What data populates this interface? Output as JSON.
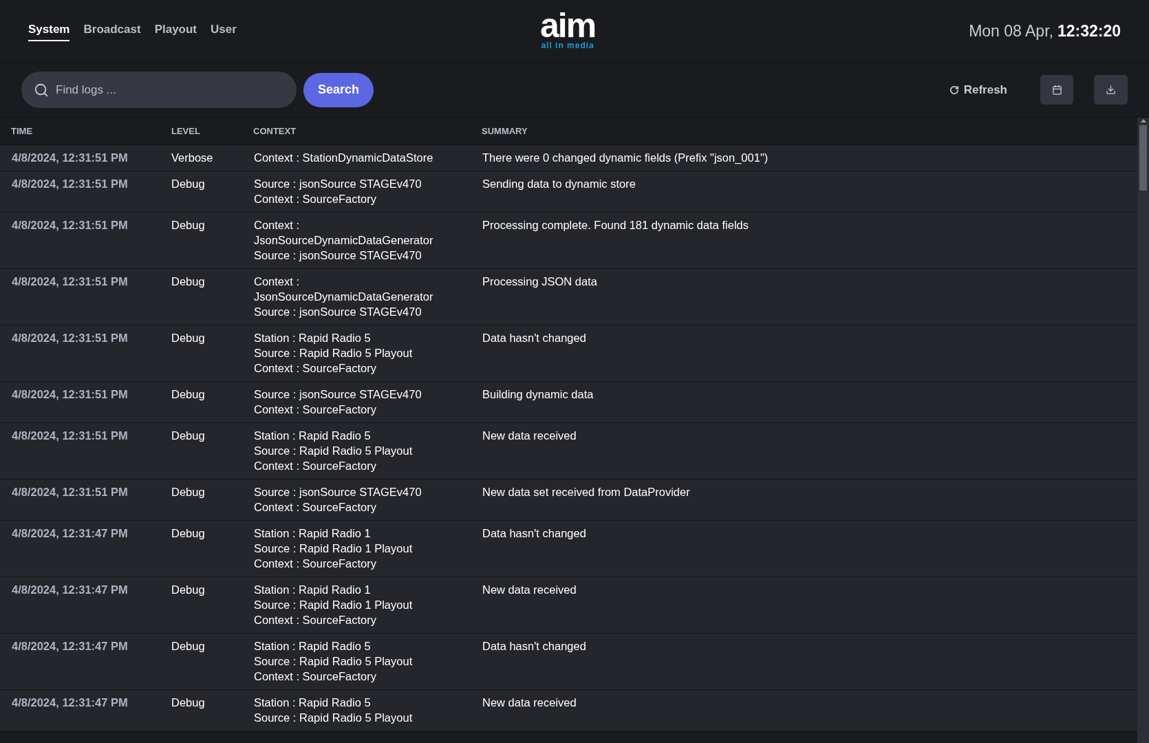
{
  "nav": {
    "tabs": [
      {
        "label": "System",
        "selected": true
      },
      {
        "label": "Broadcast",
        "selected": false
      },
      {
        "label": "Playout",
        "selected": false
      },
      {
        "label": "User",
        "selected": false
      }
    ]
  },
  "logo": {
    "wordmark": "aim",
    "tagline": "all in media"
  },
  "clock": {
    "date": "Mon 08 Apr,",
    "time": "12:32:20"
  },
  "toolbar": {
    "search": {
      "placeholder": "Find logs ..."
    },
    "search_button": "Search",
    "refresh_button": "Refresh"
  },
  "table": {
    "columns": [
      "TIME",
      "LEVEL",
      "CONTEXT",
      "SUMMARY"
    ],
    "rows": [
      {
        "time": "4/8/2024, 12:31:51 PM",
        "level": "Verbose",
        "context": [
          "Context : StationDynamicDataStore"
        ],
        "summary": "There were 0 changed dynamic fields (Prefix \"json_001\")"
      },
      {
        "time": "4/8/2024, 12:31:51 PM",
        "level": "Debug",
        "context": [
          "Source : jsonSource STAGEv470",
          "Context : SourceFactory"
        ],
        "summary": "Sending data to dynamic store"
      },
      {
        "time": "4/8/2024, 12:31:51 PM",
        "level": "Debug",
        "context": [
          "Context :",
          "JsonSourceDynamicDataGenerator",
          "Source : jsonSource STAGEv470"
        ],
        "summary": "Processing complete.  Found 181 dynamic data fields"
      },
      {
        "time": "4/8/2024, 12:31:51 PM",
        "level": "Debug",
        "context": [
          "Context :",
          "JsonSourceDynamicDataGenerator",
          "Source : jsonSource STAGEv470"
        ],
        "summary": "Processing JSON data"
      },
      {
        "time": "4/8/2024, 12:31:51 PM",
        "level": "Debug",
        "context": [
          "Station : Rapid Radio 5",
          "Source : Rapid Radio 5 Playout",
          "Context : SourceFactory"
        ],
        "summary": "Data hasn't changed"
      },
      {
        "time": "4/8/2024, 12:31:51 PM",
        "level": "Debug",
        "context": [
          "Source : jsonSource STAGEv470",
          "Context : SourceFactory"
        ],
        "summary": "Building dynamic data"
      },
      {
        "time": "4/8/2024, 12:31:51 PM",
        "level": "Debug",
        "context": [
          "Station : Rapid Radio 5",
          "Source : Rapid Radio 5 Playout",
          "Context : SourceFactory"
        ],
        "summary": "New data received"
      },
      {
        "time": "4/8/2024, 12:31:51 PM",
        "level": "Debug",
        "context": [
          "Source : jsonSource STAGEv470",
          "Context : SourceFactory"
        ],
        "summary": "New data set received from DataProvider"
      },
      {
        "time": "4/8/2024, 12:31:47 PM",
        "level": "Debug",
        "context": [
          "Station : Rapid Radio 1",
          "Source : Rapid Radio 1 Playout",
          "Context : SourceFactory"
        ],
        "summary": "Data hasn't changed"
      },
      {
        "time": "4/8/2024, 12:31:47 PM",
        "level": "Debug",
        "context": [
          "Station : Rapid Radio 1",
          "Source : Rapid Radio 1 Playout",
          "Context : SourceFactory"
        ],
        "summary": "New data received"
      },
      {
        "time": "4/8/2024, 12:31:47 PM",
        "level": "Debug",
        "context": [
          "Station : Rapid Radio 5",
          "Source : Rapid Radio 5 Playout",
          "Context : SourceFactory"
        ],
        "summary": "Data hasn't changed"
      },
      {
        "time": "4/8/2024, 12:31:47 PM",
        "level": "Debug",
        "context": [
          "Station : Rapid Radio 5",
          "Source : Rapid Radio 5 Playout"
        ],
        "summary": "New data received"
      }
    ]
  }
}
